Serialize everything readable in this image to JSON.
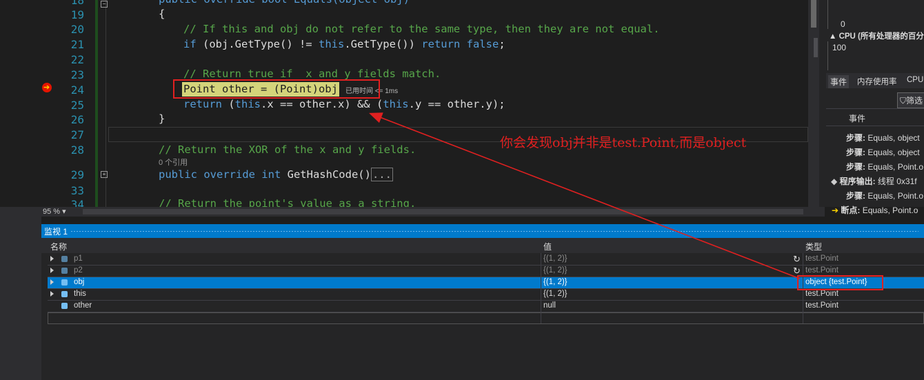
{
  "editor": {
    "lines": [
      {
        "num": "18",
        "text": "public override bool Equals(object obj)"
      },
      {
        "num": "19",
        "text": "{"
      },
      {
        "num": "20",
        "text": "// If this and obj do not refer to the same type, then they are not equal."
      },
      {
        "num": "21",
        "text_parts": [
          "if",
          " (obj.GetType() != ",
          "this",
          ".GetType()) ",
          "return",
          " ",
          "false",
          ";"
        ]
      },
      {
        "num": "22",
        "text": ""
      },
      {
        "num": "23",
        "text": "// Return true if  x and y fields match."
      },
      {
        "num": "24",
        "text": "Point other = (Point)obj;"
      },
      {
        "num": "25",
        "text_parts": [
          "return",
          " (",
          "this",
          ".x == other.x) && (",
          "this",
          ".y == other.y);"
        ]
      },
      {
        "num": "26",
        "text": "}"
      },
      {
        "num": "27",
        "text": ""
      },
      {
        "num": "28",
        "text": "// Return the XOR of the x and y fields."
      },
      {
        "num": "29",
        "text_parts": [
          "public override int",
          " GetHashCode()",
          "..."
        ]
      },
      {
        "num": "33",
        "text": ""
      },
      {
        "num": "34",
        "text": "// Return the point's value as a string."
      }
    ],
    "ref_count": "0 个引用",
    "perf_tip": "已用时间 <= 1ms",
    "zoom": "95 %"
  },
  "annotation": "你会发现obj并非是test.Point,而是object",
  "right_panel": {
    "axis_zero": "0",
    "cpu_title": "CPU (所有处理器的百分",
    "axis_hundred": "100",
    "tabs": [
      "事件",
      "内存使用率",
      "CPU"
    ],
    "filter_label": "筛选",
    "events_header": "事件",
    "events": [
      {
        "label": "步骤:",
        "value": "Equals, object"
      },
      {
        "label": "步骤:",
        "value": "Equals, object"
      },
      {
        "label": "步骤:",
        "value": "Equals, Point.o"
      },
      {
        "label": "程序输出:",
        "value": "线程 0x31f"
      },
      {
        "label": "步骤:",
        "value": "Equals, Point.o"
      },
      {
        "label": "断点:",
        "value": "Equals, Point.o"
      }
    ]
  },
  "watch": {
    "title": "监视 1",
    "columns": [
      "名称",
      "值",
      "类型"
    ],
    "rows": [
      {
        "name": "p1",
        "value": "{(1, 2)}",
        "type": "test.Point"
      },
      {
        "name": "p2",
        "value": "{(1, 2)}",
        "type": "test.Point"
      },
      {
        "name": "obj",
        "value": "{(1, 2)}",
        "type": "object {test.Point}"
      },
      {
        "name": "this",
        "value": "{(1, 2)}",
        "type": "test.Point"
      },
      {
        "name": "other",
        "value": "null",
        "type": "test.Point"
      }
    ]
  },
  "colors": {
    "accent": "#007acc",
    "annotation_red": "#e02020",
    "keyword": "#569cd6",
    "comment": "#57a64a"
  }
}
